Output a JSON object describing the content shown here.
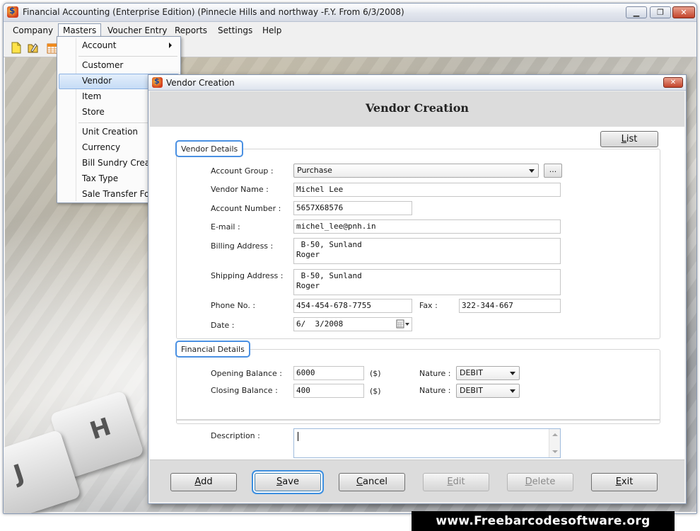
{
  "app": {
    "title": "Financial Accounting (Enterprise Edition) (Pinnecle Hills and northway -F.Y. From 6/3/2008)",
    "window_buttons": {
      "minimize": "▁",
      "restore": "❐",
      "close": "✕"
    }
  },
  "menubar": [
    "Company",
    "Masters",
    "Voucher Entry",
    "Reports",
    "Settings",
    "Help"
  ],
  "masters_menu": {
    "items": [
      "Account",
      "Customer",
      "Vendor",
      "Item",
      "Store",
      "Unit Creation",
      "Currency",
      "Bill Sundry Creati",
      "Tax Type",
      "Sale Transfer For"
    ],
    "highlighted": "Vendor"
  },
  "dialog": {
    "window_title": "Vendor Creation",
    "heading": "Vendor Creation",
    "close_glyph": "✕",
    "list_button": {
      "prefix": "",
      "accel": "L",
      "rest": "ist"
    },
    "vendor_details": {
      "title": "Vendor Details",
      "account_group": {
        "label": "Account Group :",
        "value": "Purchase",
        "browse": "..."
      },
      "vendor_name": {
        "label": "Vendor Name :",
        "value": "Michel Lee"
      },
      "account_number": {
        "label": "Account Number :",
        "value": "5657X68576"
      },
      "email": {
        "label": "E-mail :",
        "value": "michel_lee@pnh.in"
      },
      "billing_address": {
        "label": "Billing Address :",
        "value": " B-50, Sunland\nRoger"
      },
      "shipping_address": {
        "label": "Shipping Address :",
        "value": " B-50, Sunland\nRoger"
      },
      "phone": {
        "label": "Phone No. :",
        "value": "454-454-678-7755"
      },
      "fax": {
        "label": "Fax :",
        "value": "322-344-667"
      },
      "date": {
        "label": "Date :",
        "value": "6/  3/2008"
      }
    },
    "financial_details": {
      "title": "Financial Details",
      "opening_balance": {
        "label": "Opening Balance :",
        "value": "6000",
        "unit": "($)",
        "nature_label": "Nature :",
        "nature": "DEBIT"
      },
      "closing_balance": {
        "label": "Closing Balance :",
        "value": "400",
        "unit": "($)",
        "nature_label": "Nature :",
        "nature": "DEBIT"
      }
    },
    "description": {
      "label": "Description :",
      "value": ""
    },
    "buttons": [
      {
        "accel": "A",
        "rest": "dd",
        "state": "normal"
      },
      {
        "accel": "S",
        "rest": "ave",
        "state": "focused"
      },
      {
        "accel": "C",
        "rest": "ancel",
        "state": "normal"
      },
      {
        "accel": "E",
        "rest": "dit",
        "state": "disabled"
      },
      {
        "accel": "D",
        "rest": "elete",
        "state": "disabled"
      },
      {
        "accel": "E",
        "rest": "xit",
        "state": "normal"
      }
    ]
  },
  "watermark": "www.Freebarcodesoftware.org",
  "colors": {
    "focus_ring": "#3c8fe0",
    "group_label_border": "#4a90e2",
    "menu_highlight": "#c6dcf6"
  }
}
